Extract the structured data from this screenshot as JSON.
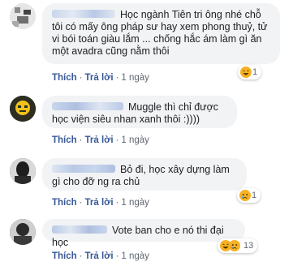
{
  "comments": [
    {
      "text": "Học ngành Tiên tri ông nhé chỗ tôi có mấy ông pháp sư hay xem phong thuỷ, tử vi bói toán giàu lắm ... chống hắc ám làm gì ăn một avadra cũng nằm thôi",
      "like": "Thích",
      "reply": "Trả lời",
      "time": "1 ngày",
      "reaction_count": "1"
    },
    {
      "text": "Muggle thì chỉ được học viện siêu nhan xanh thôi :))))",
      "like": "Thích",
      "reply": "Trả lời",
      "time": "1 ngày"
    },
    {
      "text": "Bỏ đi, học xây dựng làm gì cho đỡ ng ra chủ",
      "like": "Thích",
      "reply": "Trả lời",
      "time": "1 ngày",
      "reaction_count": "1"
    },
    {
      "text": "Vote ban cho e nó thi đại học",
      "like": "Thích",
      "reply": "Trả lời",
      "time": "1 ngày",
      "reaction_count": "13"
    }
  ],
  "colors": {
    "link": "#385898",
    "bubble": "#f2f3f5",
    "meta": "#606770",
    "emoji": "#f7b125"
  }
}
